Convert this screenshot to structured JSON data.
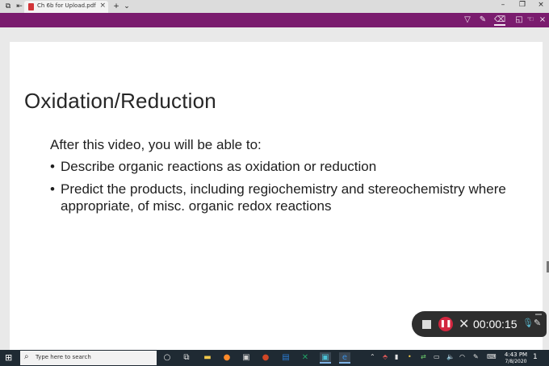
{
  "browser": {
    "tab_title": "Ch 6b for Upload.pdf",
    "tab_close": "×",
    "new_tab": "+",
    "tab_menu": "⌄",
    "min": "–",
    "restore": "❐",
    "close": "×"
  },
  "toolbar": {
    "tools": [
      "highlight-icon",
      "text-highlight-icon",
      "eraser-icon",
      "read-aloud-icon",
      "touch-select-icon",
      "close-icon"
    ]
  },
  "slide": {
    "title": "Oxidation/Reduction",
    "intro": "After this video, you will be able to:",
    "bullets": [
      "Describe organic reactions as oxidation or reduction",
      "Predict the products, including regiochemistry and stereochemistry where appropriate, of misc. organic redox reactions"
    ]
  },
  "recorder": {
    "time": "00:00:15"
  },
  "taskbar": {
    "search_placeholder": "Type here to search",
    "time": "4:43 PM",
    "date": "7/8/2020",
    "notifications": "1"
  },
  "colors": {
    "toolbar": "#7a1c6e",
    "record_red": "#d2263f",
    "taskbar": "#1f2a33"
  }
}
